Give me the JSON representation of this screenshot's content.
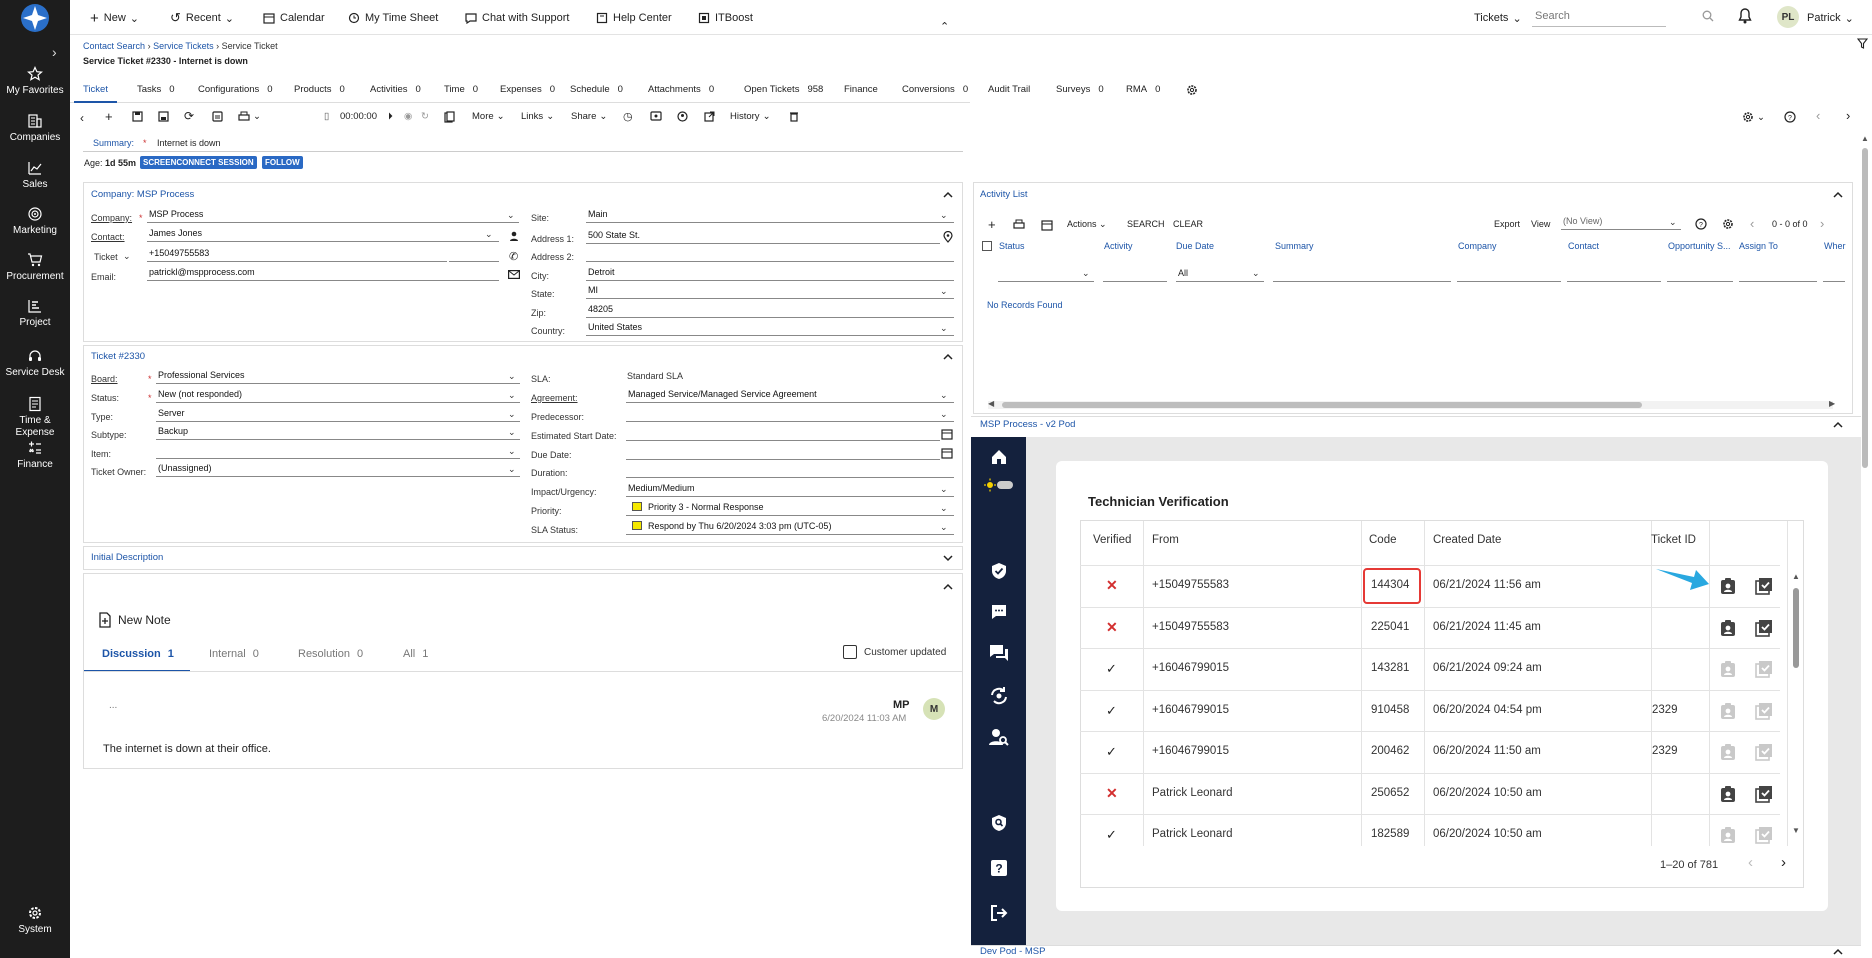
{
  "sidebar": {
    "items": [
      {
        "label": "My Favorites",
        "icon": "star-icon"
      },
      {
        "label": "Companies",
        "icon": "building-icon"
      },
      {
        "label": "Sales",
        "icon": "chart-icon"
      },
      {
        "label": "Marketing",
        "icon": "target-icon"
      },
      {
        "label": "Procurement",
        "icon": "cart-icon"
      },
      {
        "label": "Project",
        "icon": "project-icon"
      },
      {
        "label": "Service Desk",
        "icon": "headset-icon"
      },
      {
        "label": "Time & Expense",
        "icon": "time-expense-icon"
      },
      {
        "label": "Finance",
        "icon": "calculator-icon"
      },
      {
        "label": "System",
        "icon": "gear-icon"
      }
    ]
  },
  "topbar": {
    "new_label": "New",
    "recent_label": "Recent",
    "calendar_label": "Calendar",
    "timesheet_label": "My Time Sheet",
    "chat_label": "Chat with Support",
    "help_label": "Help Center",
    "itboost_label": "ITBoost",
    "module_select": "Tickets",
    "search_placeholder": "Search",
    "user_initials": "PL",
    "user_name": "Patrick"
  },
  "breadcrumb": {
    "items": [
      "Contact Search",
      "Service Tickets",
      "Service Ticket"
    ]
  },
  "page_title": "Service Ticket #2330 - Internet is down",
  "tabs": [
    {
      "label": "Ticket",
      "count": ""
    },
    {
      "label": "Tasks",
      "count": "0"
    },
    {
      "label": "Configurations",
      "count": "0"
    },
    {
      "label": "Products",
      "count": "0"
    },
    {
      "label": "Activities",
      "count": "0"
    },
    {
      "label": "Time",
      "count": "0"
    },
    {
      "label": "Expenses",
      "count": "0"
    },
    {
      "label": "Schedule",
      "count": "0"
    },
    {
      "label": "Attachments",
      "count": "0"
    },
    {
      "label": "Open Tickets",
      "count": "958"
    },
    {
      "label": "Finance",
      "count": ""
    },
    {
      "label": "Conversions",
      "count": "0"
    },
    {
      "label": "Audit Trail",
      "count": ""
    },
    {
      "label": "Surveys",
      "count": "0"
    },
    {
      "label": "RMA",
      "count": "0"
    }
  ],
  "toolbar": {
    "timer": "00:00:00",
    "more_label": "More",
    "links_label": "Links",
    "share_label": "Share",
    "history_label": "History"
  },
  "summary": {
    "label": "Summary:",
    "value": "Internet is down"
  },
  "age": {
    "label": "Age:",
    "value": "1d 55m"
  },
  "badges": {
    "screenconnect": "SCREENCONNECT SESSION",
    "follow": "FOLLOW"
  },
  "company_panel": {
    "title": "Company: MSP Process",
    "company_label": "Company:",
    "company_value": "MSP Process",
    "contact_label": "Contact:",
    "contact_value": "James Jones",
    "phone_type": "Ticket",
    "phone_value": "+15049755583",
    "email_label": "Email:",
    "email_value": "patrickl@mspprocess.com",
    "site_label": "Site:",
    "site_value": "Main",
    "address1_label": "Address 1:",
    "address1_value": "500 State St.",
    "address2_label": "Address 2:",
    "address2_value": "",
    "city_label": "City:",
    "city_value": "Detroit",
    "state_label": "State:",
    "state_value": "MI",
    "zip_label": "Zip:",
    "zip_value": "48205",
    "country_label": "Country:",
    "country_value": "United States"
  },
  "ticket_panel": {
    "title": "Ticket #2330",
    "board_label": "Board:",
    "board_value": "Professional Services",
    "status_label": "Status:",
    "status_value": "New (not responded)",
    "type_label": "Type:",
    "type_value": "Server",
    "subtype_label": "Subtype:",
    "subtype_value": "Backup",
    "item_label": "Item:",
    "item_value": "",
    "owner_label": "Ticket Owner:",
    "owner_value": "(Unassigned)",
    "sla_label": "SLA:",
    "sla_value": "Standard SLA",
    "agreement_label": "Agreement:",
    "agreement_value": "Managed Service/Managed Service Agreement",
    "predecessor_label": "Predecessor:",
    "est_start_label": "Estimated Start Date:",
    "due_label": "Due Date:",
    "duration_label": "Duration:",
    "impact_label": "Impact/Urgency:",
    "impact_value": "Medium/Medium",
    "priority_label": "Priority:",
    "priority_value": "Priority 3 - Normal Response",
    "sla_status_label": "SLA Status:",
    "sla_status_value": "Respond by Thu 6/20/2024 3:03 pm (UTC-05)"
  },
  "initial_description": {
    "title": "Initial Description"
  },
  "notes": {
    "new_note_label": "New Note",
    "tabs": [
      {
        "label": "Discussion",
        "count": "1"
      },
      {
        "label": "Internal",
        "count": "0"
      },
      {
        "label": "Resolution",
        "count": "0"
      },
      {
        "label": "All",
        "count": "1"
      }
    ],
    "customer_updated_label": "Customer updated",
    "note": {
      "ellipsis": "...",
      "initials": "MP",
      "avatar": "M",
      "timestamp": "6/20/2024 11:03 AM",
      "text": "The internet is down at their office."
    }
  },
  "activity_list": {
    "title": "Activity List",
    "actions_label": "Actions",
    "search_label": "SEARCH",
    "clear_label": "CLEAR",
    "export_label": "Export",
    "view_label": "View",
    "view_value": "(No View)",
    "pager": "0 - 0 of 0",
    "columns": [
      "Status",
      "Activity",
      "Due Date",
      "Summary",
      "Company",
      "Contact",
      "Opportunity S...",
      "Assign To",
      "Wher"
    ],
    "due_filter": "All",
    "empty_text": "No Records Found"
  },
  "pod": {
    "title": "MSP Process - v2 Pod",
    "card_title": "Technician Verification",
    "columns": [
      "Verified",
      "From",
      "Code",
      "Created Date",
      "Ticket ID"
    ],
    "rows": [
      {
        "verified": false,
        "from": "+15049755583",
        "code": "144304",
        "created": "06/21/2024 11:56 am",
        "ticket_id": "",
        "actions_enabled": true
      },
      {
        "verified": false,
        "from": "+15049755583",
        "code": "225041",
        "created": "06/21/2024 11:45 am",
        "ticket_id": "",
        "actions_enabled": true
      },
      {
        "verified": true,
        "from": "+16046799015",
        "code": "143281",
        "created": "06/21/2024 09:24 am",
        "ticket_id": "",
        "actions_enabled": false
      },
      {
        "verified": true,
        "from": "+16046799015",
        "code": "910458",
        "created": "06/20/2024 04:54 pm",
        "ticket_id": "2329",
        "actions_enabled": false
      },
      {
        "verified": true,
        "from": "+16046799015",
        "code": "200462",
        "created": "06/20/2024 11:50 am",
        "ticket_id": "2329",
        "actions_enabled": false
      },
      {
        "verified": false,
        "from": "Patrick Leonard",
        "code": "250652",
        "created": "06/20/2024 10:50 am",
        "ticket_id": "",
        "actions_enabled": true
      },
      {
        "verified": true,
        "from": "Patrick Leonard",
        "code": "182589",
        "created": "06/20/2024 10:50 am",
        "ticket_id": "",
        "actions_enabled": false
      }
    ],
    "pager": "1–20 of 781"
  },
  "dev_pod": {
    "title": "Dev Pod - MSP"
  },
  "colors": {
    "sidebar": "#1d1d1d",
    "accent": "#1d55a8",
    "pod_nav": "#14213d",
    "highlight": "#e53935",
    "arrow": "#29a8e0"
  }
}
